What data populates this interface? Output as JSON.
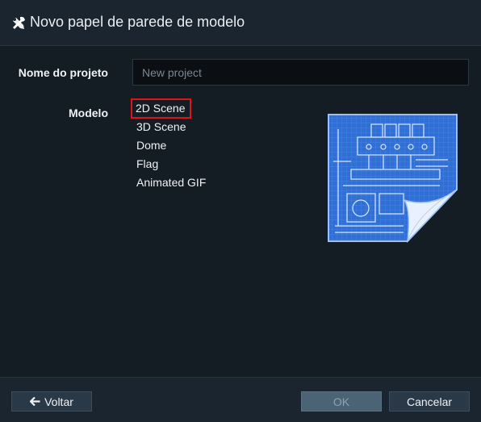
{
  "dialog": {
    "title": "Novo papel de parede de modelo"
  },
  "form": {
    "project_name_label": "Nome do projeto",
    "project_name_placeholder": "New project",
    "project_name_value": "",
    "model_label": "Modelo",
    "models": [
      "2D Scene",
      "3D Scene",
      "Dome",
      "Flag",
      "Animated GIF"
    ],
    "selected_model": "2D Scene"
  },
  "footer": {
    "back_label": "Voltar",
    "ok_label": "OK",
    "cancel_label": "Cancelar"
  },
  "colors": {
    "background": "#141c24",
    "selection_outline": "#e0131b",
    "blueprint": "#2f6fd6"
  },
  "icons": {
    "title": "tools-icon",
    "back": "arrow-left-icon",
    "preview": "blueprint-icon"
  }
}
